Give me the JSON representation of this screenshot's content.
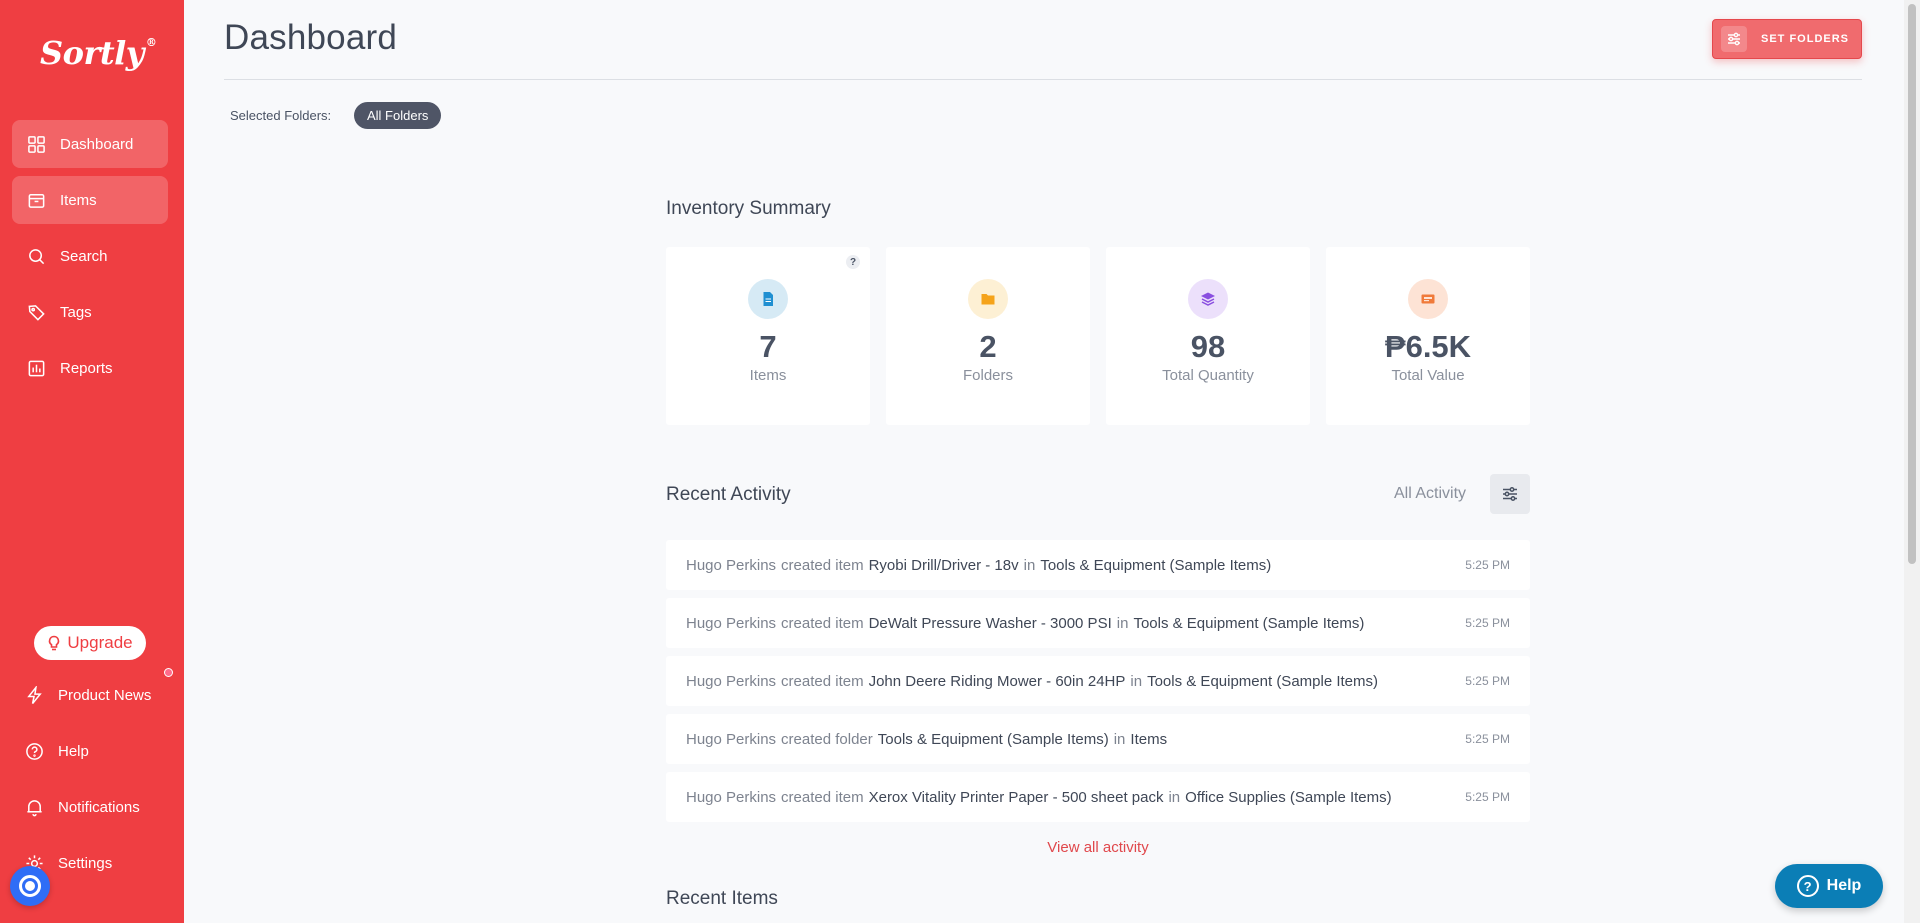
{
  "brand": {
    "name": "Sortly",
    "mark": "®"
  },
  "sidebar": {
    "items": [
      {
        "label": "Dashboard",
        "icon": "grid-icon"
      },
      {
        "label": "Items",
        "icon": "box-icon"
      },
      {
        "label": "Search",
        "icon": "search-icon"
      },
      {
        "label": "Tags",
        "icon": "tag-icon"
      },
      {
        "label": "Reports",
        "icon": "bar-chart-icon"
      }
    ],
    "upgrade_label": "Upgrade",
    "bottom": [
      {
        "label": "Product News",
        "icon": "lightning-icon"
      },
      {
        "label": "Help",
        "icon": "help-circle-icon"
      },
      {
        "label": "Notifications",
        "icon": "bell-icon"
      },
      {
        "label": "Settings",
        "icon": "gear-icon"
      }
    ]
  },
  "header": {
    "title": "Dashboard",
    "set_folders_label": "SET FOLDERS",
    "selected_folders_label": "Selected Folders:",
    "selected_chip": "All Folders"
  },
  "summary": {
    "title": "Inventory Summary",
    "cards": [
      {
        "value": "7",
        "label": "Items",
        "icon": "document-icon",
        "color": "#1f8fd1",
        "bg": "#d6eaf5"
      },
      {
        "value": "2",
        "label": "Folders",
        "icon": "folder-icon",
        "color": "#f5a31a",
        "bg": "#fdf0d4"
      },
      {
        "value": "98",
        "label": "Total Quantity",
        "icon": "layers-icon",
        "color": "#8a4fe0",
        "bg": "#ece0fb"
      },
      {
        "value": "₱6.5K",
        "label": "Total Value",
        "icon": "money-icon",
        "color": "#f07a3a",
        "bg": "#fde3d5"
      }
    ],
    "help_mark": "?"
  },
  "activity": {
    "title": "Recent Activity",
    "filter_label": "All Activity",
    "rows": [
      {
        "user": "Hugo Perkins",
        "action": "created item",
        "target": "Ryobi Drill/Driver - 18v",
        "prep": "in",
        "location": "Tools & Equipment (Sample Items)",
        "time": "5:25 PM"
      },
      {
        "user": "Hugo Perkins",
        "action": "created item",
        "target": "DeWalt Pressure Washer - 3000 PSI",
        "prep": "in",
        "location": "Tools & Equipment (Sample Items)",
        "time": "5:25 PM"
      },
      {
        "user": "Hugo Perkins",
        "action": "created item",
        "target": "John Deere Riding Mower - 60in 24HP",
        "prep": "in",
        "location": "Tools & Equipment (Sample Items)",
        "time": "5:25 PM"
      },
      {
        "user": "Hugo Perkins",
        "action": "created folder",
        "target": "Tools & Equipment (Sample Items)",
        "prep": "in",
        "location": "Items",
        "time": "5:25 PM"
      },
      {
        "user": "Hugo Perkins",
        "action": "created item",
        "target": "Xerox Vitality Printer Paper - 500 sheet pack",
        "prep": "in",
        "location": "Office Supplies (Sample Items)",
        "time": "5:25 PM"
      }
    ],
    "view_all_label": "View all activity"
  },
  "recent_items": {
    "title": "Recent Items"
  },
  "help_widget": {
    "label": "Help",
    "mark": "?"
  },
  "colors": {
    "brand": "#ef3e42",
    "help_blue": "#0b7eb6"
  }
}
